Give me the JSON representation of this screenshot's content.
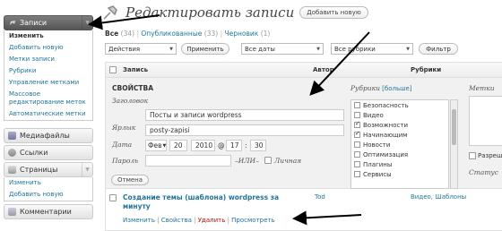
{
  "menu": {
    "posts": {
      "label": "Записи",
      "items": [
        "Изменить",
        "Добавить новую",
        "Метки записи",
        "Рубрики",
        "Управление метками",
        "Массовое редактирование меток",
        "Автоматические метки"
      ]
    },
    "media": "Медиафайлы",
    "links": "Ссылки",
    "pages": {
      "label": "Страницы",
      "items": [
        "Изменить",
        "Добавить новую"
      ]
    },
    "comments": "Комментарии"
  },
  "header": {
    "title": "Редактировать записи",
    "add_new": "Добавить новую"
  },
  "filters": {
    "all": "Все",
    "all_count": "(34)",
    "sep1": "|",
    "published": "Опубликованные",
    "published_count": "(33)",
    "sep2": "|",
    "draft": "Черновик",
    "draft_count": "(1)"
  },
  "toolbar": {
    "actions": "Действия",
    "apply": "Применить",
    "dates": "Все даты",
    "categories": "Все рубрики",
    "filter": "Фильтр"
  },
  "table": {
    "col_post": "Запись",
    "col_author": "Автор",
    "col_categories": "Рубрики"
  },
  "quick_edit": {
    "heading": "СВОЙСТВА",
    "title_label": "Заголовок",
    "title_value": "Посты и записи wordpress",
    "slug_label": "Ярлык",
    "slug_value": "posty-zapisi",
    "date_label": "Дата",
    "month": "Фев",
    "day": "20",
    "year": "2010",
    "at": "@",
    "hour": "17",
    "colon": ":",
    "minute": "30",
    "password_label": "Пароль",
    "or": "–ИЛИ–",
    "private": "Личная",
    "cancel": "Отмена",
    "cats_label": "Рубрики",
    "cats_more": "[больше]",
    "categories": [
      {
        "name": "Безопасность",
        "checked": false
      },
      {
        "name": "Видео",
        "checked": false
      },
      {
        "name": "Возможности",
        "checked": true
      },
      {
        "name": "Начинающим",
        "checked": true
      },
      {
        "name": "Новости",
        "checked": false
      },
      {
        "name": "Оптимизация",
        "checked": false
      },
      {
        "name": "Плагины",
        "checked": false
      },
      {
        "name": "Сервисы",
        "checked": false
      }
    ],
    "tags_label": "Метки",
    "allow_label": "Разреш",
    "status_label": "Статус"
  },
  "post_row": {
    "title_line1": "Создание темы (шаблона) wordpress за",
    "title_line2": "минуту",
    "author": "Tod",
    "categories": "Видео, Шаблоны",
    "edit": "Изменить",
    "properties": "Свойства",
    "delete": "Удалить",
    "view": "Просмотреть",
    "sep": "|"
  },
  "colors": {
    "accent": "#21759b",
    "delete": "#bc0b0b",
    "menu_current": "#636363"
  }
}
